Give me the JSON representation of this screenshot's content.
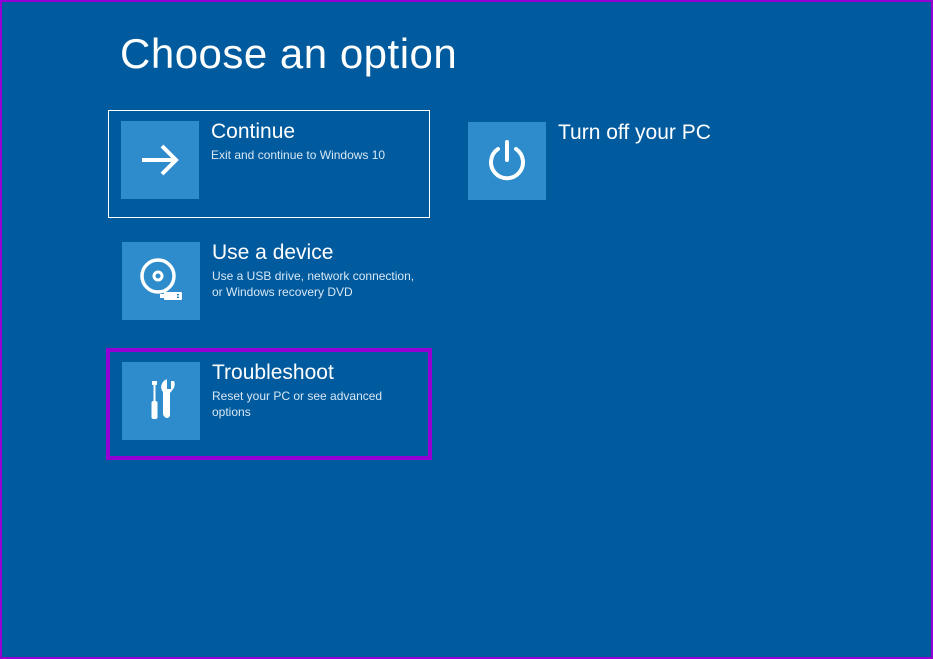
{
  "title": "Choose an option",
  "tiles": {
    "continue": {
      "title": "Continue",
      "desc": "Exit and continue to Windows 10"
    },
    "turnoff": {
      "title": "Turn off your PC",
      "desc": ""
    },
    "device": {
      "title": "Use a device",
      "desc": "Use a USB drive, network connection, or Windows recovery DVD"
    },
    "troubleshoot": {
      "title": "Troubleshoot",
      "desc": "Reset your PC or see advanced options"
    }
  },
  "colors": {
    "background": "#005a9e",
    "tile_icon_bg": "#2e8ccc",
    "highlight": "#9400d3"
  }
}
